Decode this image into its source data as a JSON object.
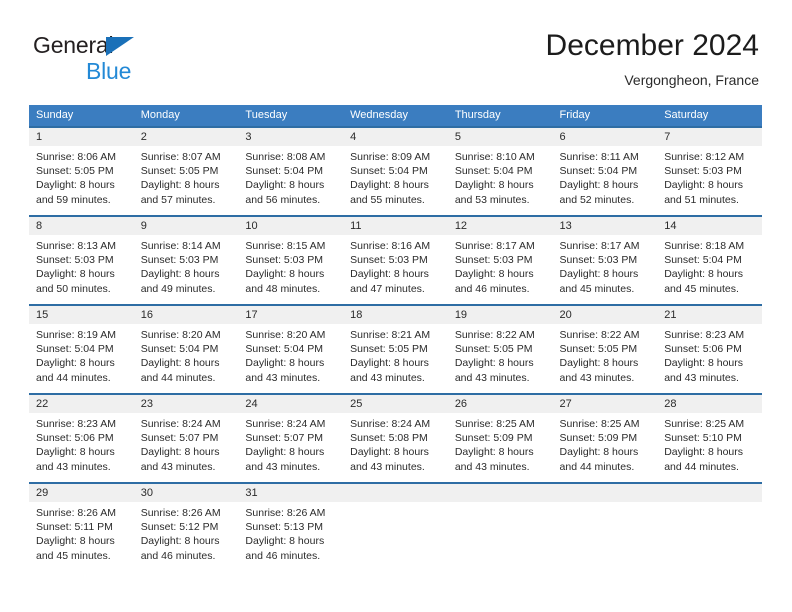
{
  "brand": {
    "line1": "General",
    "line2": "Blue",
    "triangle_color": "#1a70b8",
    "text_color": "#231f20",
    "blue_text_color": "#2389d6"
  },
  "header": {
    "title": "December 2024",
    "location": "Vergongheon, France"
  },
  "theme": {
    "header_bg": "#3b7dc0",
    "week_rule": "#2e6da4",
    "daynum_bg": "#f0f0f0"
  },
  "weekday_headers": [
    "Sunday",
    "Monday",
    "Tuesday",
    "Wednesday",
    "Thursday",
    "Friday",
    "Saturday"
  ],
  "weeks": [
    [
      {
        "day": "1",
        "sunrise": "Sunrise: 8:06 AM",
        "sunset": "Sunset: 5:05 PM",
        "daylight1": "Daylight: 8 hours",
        "daylight2": "and 59 minutes."
      },
      {
        "day": "2",
        "sunrise": "Sunrise: 8:07 AM",
        "sunset": "Sunset: 5:05 PM",
        "daylight1": "Daylight: 8 hours",
        "daylight2": "and 57 minutes."
      },
      {
        "day": "3",
        "sunrise": "Sunrise: 8:08 AM",
        "sunset": "Sunset: 5:04 PM",
        "daylight1": "Daylight: 8 hours",
        "daylight2": "and 56 minutes."
      },
      {
        "day": "4",
        "sunrise": "Sunrise: 8:09 AM",
        "sunset": "Sunset: 5:04 PM",
        "daylight1": "Daylight: 8 hours",
        "daylight2": "and 55 minutes."
      },
      {
        "day": "5",
        "sunrise": "Sunrise: 8:10 AM",
        "sunset": "Sunset: 5:04 PM",
        "daylight1": "Daylight: 8 hours",
        "daylight2": "and 53 minutes."
      },
      {
        "day": "6",
        "sunrise": "Sunrise: 8:11 AM",
        "sunset": "Sunset: 5:04 PM",
        "daylight1": "Daylight: 8 hours",
        "daylight2": "and 52 minutes."
      },
      {
        "day": "7",
        "sunrise": "Sunrise: 8:12 AM",
        "sunset": "Sunset: 5:03 PM",
        "daylight1": "Daylight: 8 hours",
        "daylight2": "and 51 minutes."
      }
    ],
    [
      {
        "day": "8",
        "sunrise": "Sunrise: 8:13 AM",
        "sunset": "Sunset: 5:03 PM",
        "daylight1": "Daylight: 8 hours",
        "daylight2": "and 50 minutes."
      },
      {
        "day": "9",
        "sunrise": "Sunrise: 8:14 AM",
        "sunset": "Sunset: 5:03 PM",
        "daylight1": "Daylight: 8 hours",
        "daylight2": "and 49 minutes."
      },
      {
        "day": "10",
        "sunrise": "Sunrise: 8:15 AM",
        "sunset": "Sunset: 5:03 PM",
        "daylight1": "Daylight: 8 hours",
        "daylight2": "and 48 minutes."
      },
      {
        "day": "11",
        "sunrise": "Sunrise: 8:16 AM",
        "sunset": "Sunset: 5:03 PM",
        "daylight1": "Daylight: 8 hours",
        "daylight2": "and 47 minutes."
      },
      {
        "day": "12",
        "sunrise": "Sunrise: 8:17 AM",
        "sunset": "Sunset: 5:03 PM",
        "daylight1": "Daylight: 8 hours",
        "daylight2": "and 46 minutes."
      },
      {
        "day": "13",
        "sunrise": "Sunrise: 8:17 AM",
        "sunset": "Sunset: 5:03 PM",
        "daylight1": "Daylight: 8 hours",
        "daylight2": "and 45 minutes."
      },
      {
        "day": "14",
        "sunrise": "Sunrise: 8:18 AM",
        "sunset": "Sunset: 5:04 PM",
        "daylight1": "Daylight: 8 hours",
        "daylight2": "and 45 minutes."
      }
    ],
    [
      {
        "day": "15",
        "sunrise": "Sunrise: 8:19 AM",
        "sunset": "Sunset: 5:04 PM",
        "daylight1": "Daylight: 8 hours",
        "daylight2": "and 44 minutes."
      },
      {
        "day": "16",
        "sunrise": "Sunrise: 8:20 AM",
        "sunset": "Sunset: 5:04 PM",
        "daylight1": "Daylight: 8 hours",
        "daylight2": "and 44 minutes."
      },
      {
        "day": "17",
        "sunrise": "Sunrise: 8:20 AM",
        "sunset": "Sunset: 5:04 PM",
        "daylight1": "Daylight: 8 hours",
        "daylight2": "and 43 minutes."
      },
      {
        "day": "18",
        "sunrise": "Sunrise: 8:21 AM",
        "sunset": "Sunset: 5:05 PM",
        "daylight1": "Daylight: 8 hours",
        "daylight2": "and 43 minutes."
      },
      {
        "day": "19",
        "sunrise": "Sunrise: 8:22 AM",
        "sunset": "Sunset: 5:05 PM",
        "daylight1": "Daylight: 8 hours",
        "daylight2": "and 43 minutes."
      },
      {
        "day": "20",
        "sunrise": "Sunrise: 8:22 AM",
        "sunset": "Sunset: 5:05 PM",
        "daylight1": "Daylight: 8 hours",
        "daylight2": "and 43 minutes."
      },
      {
        "day": "21",
        "sunrise": "Sunrise: 8:23 AM",
        "sunset": "Sunset: 5:06 PM",
        "daylight1": "Daylight: 8 hours",
        "daylight2": "and 43 minutes."
      }
    ],
    [
      {
        "day": "22",
        "sunrise": "Sunrise: 8:23 AM",
        "sunset": "Sunset: 5:06 PM",
        "daylight1": "Daylight: 8 hours",
        "daylight2": "and 43 minutes."
      },
      {
        "day": "23",
        "sunrise": "Sunrise: 8:24 AM",
        "sunset": "Sunset: 5:07 PM",
        "daylight1": "Daylight: 8 hours",
        "daylight2": "and 43 minutes."
      },
      {
        "day": "24",
        "sunrise": "Sunrise: 8:24 AM",
        "sunset": "Sunset: 5:07 PM",
        "daylight1": "Daylight: 8 hours",
        "daylight2": "and 43 minutes."
      },
      {
        "day": "25",
        "sunrise": "Sunrise: 8:24 AM",
        "sunset": "Sunset: 5:08 PM",
        "daylight1": "Daylight: 8 hours",
        "daylight2": "and 43 minutes."
      },
      {
        "day": "26",
        "sunrise": "Sunrise: 8:25 AM",
        "sunset": "Sunset: 5:09 PM",
        "daylight1": "Daylight: 8 hours",
        "daylight2": "and 43 minutes."
      },
      {
        "day": "27",
        "sunrise": "Sunrise: 8:25 AM",
        "sunset": "Sunset: 5:09 PM",
        "daylight1": "Daylight: 8 hours",
        "daylight2": "and 44 minutes."
      },
      {
        "day": "28",
        "sunrise": "Sunrise: 8:25 AM",
        "sunset": "Sunset: 5:10 PM",
        "daylight1": "Daylight: 8 hours",
        "daylight2": "and 44 minutes."
      }
    ],
    [
      {
        "day": "29",
        "sunrise": "Sunrise: 8:26 AM",
        "sunset": "Sunset: 5:11 PM",
        "daylight1": "Daylight: 8 hours",
        "daylight2": "and 45 minutes."
      },
      {
        "day": "30",
        "sunrise": "Sunrise: 8:26 AM",
        "sunset": "Sunset: 5:12 PM",
        "daylight1": "Daylight: 8 hours",
        "daylight2": "and 46 minutes."
      },
      {
        "day": "31",
        "sunrise": "Sunrise: 8:26 AM",
        "sunset": "Sunset: 5:13 PM",
        "daylight1": "Daylight: 8 hours",
        "daylight2": "and 46 minutes."
      },
      {
        "day": "",
        "sunrise": "",
        "sunset": "",
        "daylight1": "",
        "daylight2": ""
      },
      {
        "day": "",
        "sunrise": "",
        "sunset": "",
        "daylight1": "",
        "daylight2": ""
      },
      {
        "day": "",
        "sunrise": "",
        "sunset": "",
        "daylight1": "",
        "daylight2": ""
      },
      {
        "day": "",
        "sunrise": "",
        "sunset": "",
        "daylight1": "",
        "daylight2": ""
      }
    ]
  ]
}
